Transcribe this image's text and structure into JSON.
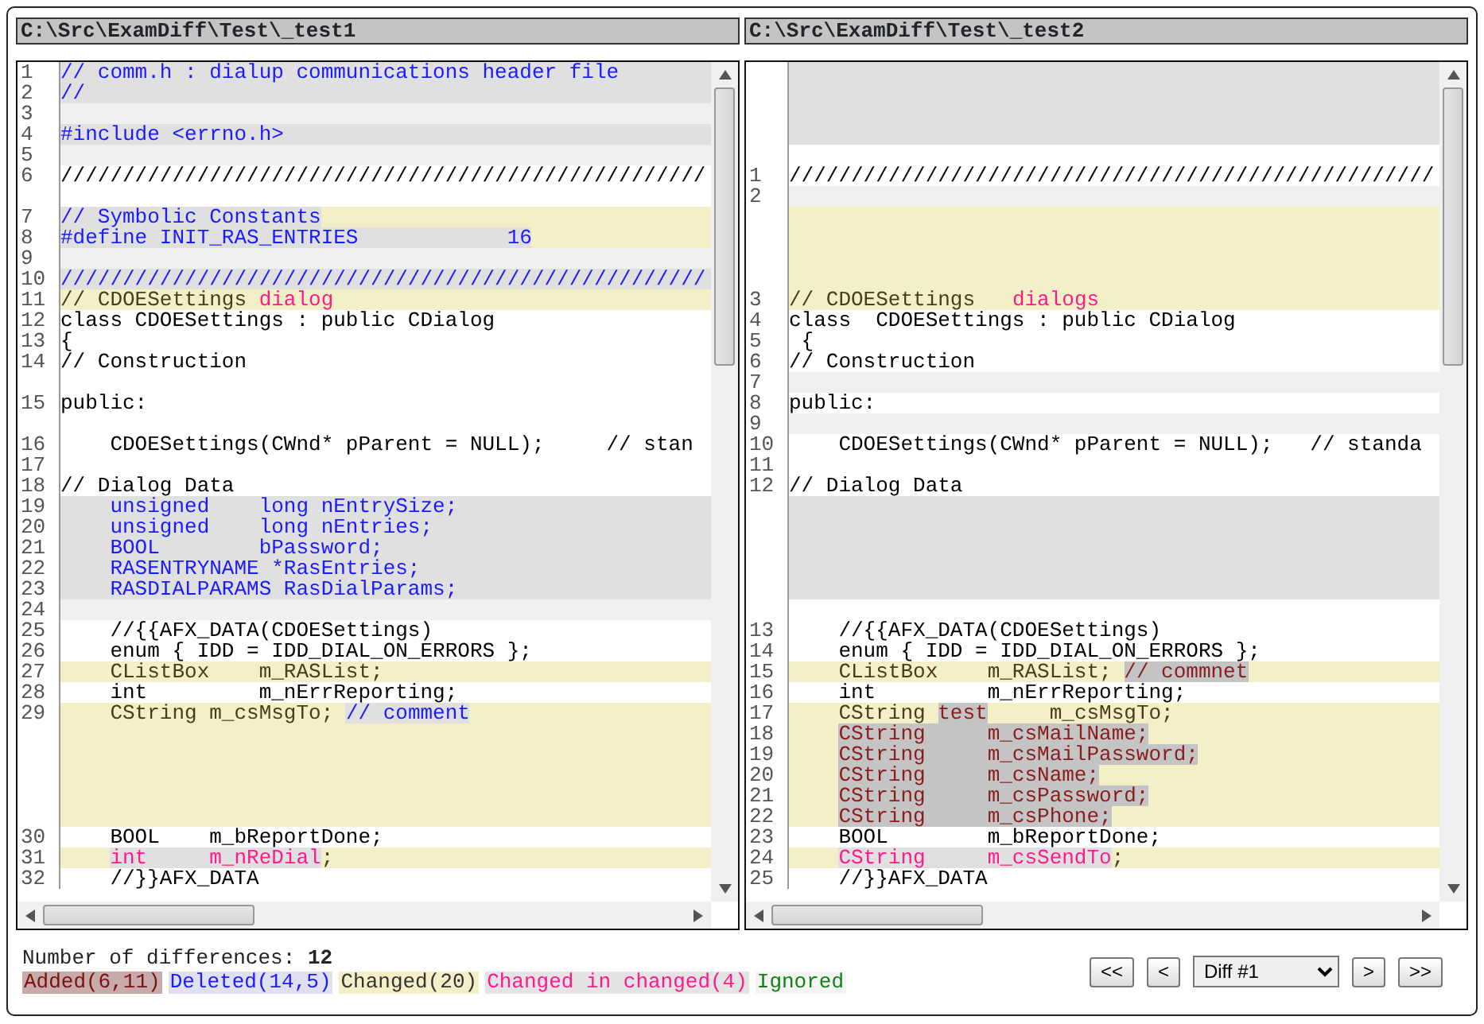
{
  "panes": [
    {
      "path": "C:\\Src\\ExamDiff\\Test\\_test1",
      "lines": [
        {
          "num": "1",
          "kind": "deleted",
          "segments": [
            {
              "text": "// comm.h : dialup communications header file",
              "kind": "plain"
            }
          ]
        },
        {
          "num": "2",
          "kind": "deleted",
          "segments": [
            {
              "text": "//",
              "kind": "plain"
            }
          ]
        },
        {
          "num": "3",
          "kind": "ignored"
        },
        {
          "num": "4",
          "kind": "deleted",
          "segments": [
            {
              "text": "#include <errno.h>",
              "kind": "plain"
            }
          ]
        },
        {
          "num": "5",
          "kind": "ignored"
        },
        {
          "num": "6",
          "kind": "same",
          "segments": [
            {
              "text": "////////////////////////////////////////////////////",
              "kind": "plain"
            }
          ]
        },
        {
          "kind": "same"
        },
        {
          "num": "7",
          "kind": "changed",
          "segments": [
            {
              "text": "// Symbolic Constants",
              "kind": "del-hl"
            }
          ]
        },
        {
          "num": "8",
          "kind": "changed",
          "segments": [
            {
              "text": "#define INIT_RAS_ENTRIES            16",
              "kind": "del-hl"
            }
          ]
        },
        {
          "num": "9",
          "kind": "ignored"
        },
        {
          "num": "10",
          "kind": "deleted",
          "segments": [
            {
              "text": "////////////////////////////////////////////////////",
              "kind": "plain"
            }
          ]
        },
        {
          "num": "11",
          "kind": "changed",
          "segments": [
            {
              "text": "// CDOESettings ",
              "kind": "plain"
            },
            {
              "text": "dialog",
              "kind": "cic"
            }
          ]
        },
        {
          "num": "12",
          "kind": "same",
          "segments": [
            {
              "text": "class CDOESettings : public CDialog",
              "kind": "plain"
            }
          ]
        },
        {
          "num": "13",
          "kind": "same",
          "segments": [
            {
              "text": "{",
              "kind": "plain"
            }
          ]
        },
        {
          "num": "14",
          "kind": "same",
          "segments": [
            {
              "text": "// Construction",
              "kind": "plain"
            }
          ]
        },
        {
          "kind": "same"
        },
        {
          "num": "15",
          "kind": "same",
          "segments": [
            {
              "text": "public:",
              "kind": "plain"
            }
          ]
        },
        {
          "kind": "same"
        },
        {
          "num": "16",
          "kind": "same",
          "segments": [
            {
              "text": "    CDOESettings(CWnd* pParent = NULL);     // stan",
              "kind": "plain"
            }
          ]
        },
        {
          "num": "17",
          "kind": "same"
        },
        {
          "num": "18",
          "kind": "same",
          "segments": [
            {
              "text": "// Dialog Data",
              "kind": "plain"
            }
          ]
        },
        {
          "num": "19",
          "kind": "deleted",
          "segments": [
            {
              "text": "    unsigned    long nEntrySize;",
              "kind": "plain"
            }
          ]
        },
        {
          "num": "20",
          "kind": "deleted",
          "segments": [
            {
              "text": "    unsigned    long nEntries;",
              "kind": "plain"
            }
          ]
        },
        {
          "num": "21",
          "kind": "deleted",
          "segments": [
            {
              "text": "    BOOL        bPassword;",
              "kind": "plain"
            }
          ]
        },
        {
          "num": "22",
          "kind": "deleted",
          "segments": [
            {
              "text": "    RASENTRYNAME *RasEntries;",
              "kind": "plain"
            }
          ]
        },
        {
          "num": "23",
          "kind": "deleted",
          "segments": [
            {
              "text": "    RASDIALPARAMS RasDialParams;",
              "kind": "plain"
            }
          ]
        },
        {
          "num": "24",
          "kind": "ignored"
        },
        {
          "num": "25",
          "kind": "same",
          "segments": [
            {
              "text": "    //{{AFX_DATA(CDOESettings)",
              "kind": "plain"
            }
          ]
        },
        {
          "num": "26",
          "kind": "same",
          "segments": [
            {
              "text": "    enum { IDD = IDD_DIAL_ON_ERRORS };",
              "kind": "plain"
            }
          ]
        },
        {
          "num": "27",
          "kind": "changed",
          "segments": [
            {
              "text": "    CListBox    m_RASList;",
              "kind": "plain"
            }
          ]
        },
        {
          "num": "28",
          "kind": "same",
          "segments": [
            {
              "text": "    int         m_nErrReporting;",
              "kind": "plain"
            }
          ]
        },
        {
          "num": "29",
          "kind": "changed",
          "segments": [
            {
              "text": "    CString m_csMsgTo; ",
              "kind": "plain"
            },
            {
              "text": "// comment",
              "kind": "del-hl"
            }
          ]
        },
        {
          "kind": "changed"
        },
        {
          "kind": "changed"
        },
        {
          "kind": "changed"
        },
        {
          "kind": "changed"
        },
        {
          "kind": "changed"
        },
        {
          "num": "30",
          "kind": "same",
          "segments": [
            {
              "text": "    BOOL    m_bReportDone;",
              "kind": "plain"
            }
          ]
        },
        {
          "num": "31",
          "kind": "changed",
          "indented": true,
          "segments": [
            {
              "text": "int     m_nReDial",
              "kind": "cic-hl"
            },
            {
              "text": ";",
              "kind": "plain"
            }
          ]
        },
        {
          "num": "32",
          "kind": "same",
          "segments": [
            {
              "text": "    //}}AFX_DATA",
              "kind": "plain"
            }
          ]
        }
      ]
    },
    {
      "path": "C:\\Src\\ExamDiff\\Test\\_test2",
      "lines": [
        {
          "kind": "deleted"
        },
        {
          "kind": "deleted"
        },
        {
          "kind": "deleted"
        },
        {
          "kind": "deleted"
        },
        {
          "kind": "same"
        },
        {
          "num": "1",
          "kind": "same",
          "segments": [
            {
              "text": "////////////////////////////////////////////////////",
              "kind": "plain"
            }
          ]
        },
        {
          "num": "2",
          "kind": "ignored"
        },
        {
          "kind": "changed"
        },
        {
          "kind": "changed"
        },
        {
          "kind": "changed"
        },
        {
          "kind": "changed"
        },
        {
          "num": "3",
          "kind": "changed",
          "segments": [
            {
              "text": "// CDOESettings   ",
              "kind": "plain"
            },
            {
              "text": "dialogs",
              "kind": "cic"
            }
          ]
        },
        {
          "num": "4",
          "kind": "same",
          "segments": [
            {
              "text": "class  CDOESettings : public CDialog",
              "kind": "plain"
            }
          ]
        },
        {
          "num": "5",
          "kind": "same",
          "segments": [
            {
              "text": " {",
              "kind": "plain"
            }
          ]
        },
        {
          "num": "6",
          "kind": "same",
          "segments": [
            {
              "text": "// Construction",
              "kind": "plain"
            }
          ]
        },
        {
          "num": "7",
          "kind": "ignored"
        },
        {
          "num": "8",
          "kind": "same",
          "segments": [
            {
              "text": "public:",
              "kind": "plain"
            }
          ]
        },
        {
          "num": "9",
          "kind": "ignored"
        },
        {
          "num": "10",
          "kind": "same",
          "segments": [
            {
              "text": "    CDOESettings(CWnd* pParent = NULL);   // standa",
              "kind": "plain"
            }
          ]
        },
        {
          "num": "11",
          "kind": "same"
        },
        {
          "num": "12",
          "kind": "same",
          "segments": [
            {
              "text": "// Dialog Data",
              "kind": "plain"
            }
          ]
        },
        {
          "kind": "deleted"
        },
        {
          "kind": "deleted"
        },
        {
          "kind": "deleted"
        },
        {
          "kind": "deleted"
        },
        {
          "kind": "deleted"
        },
        {
          "kind": "same"
        },
        {
          "num": "13",
          "kind": "same",
          "segments": [
            {
              "text": "    //{{AFX_DATA(CDOESettings)",
              "kind": "plain"
            }
          ]
        },
        {
          "num": "14",
          "kind": "same",
          "segments": [
            {
              "text": "    enum { IDD = IDD_DIAL_ON_ERRORS };",
              "kind": "plain"
            }
          ]
        },
        {
          "num": "15",
          "kind": "changed",
          "segments": [
            {
              "text": "    CListBox    m_RASList; ",
              "kind": "plain"
            },
            {
              "text": "// commnet",
              "kind": "add-hl"
            }
          ]
        },
        {
          "num": "16",
          "kind": "same",
          "segments": [
            {
              "text": "    int         m_nErrReporting;",
              "kind": "plain"
            }
          ]
        },
        {
          "num": "17",
          "kind": "changed",
          "segments": [
            {
              "text": "    CString ",
              "kind": "plain"
            },
            {
              "text": "test",
              "kind": "add-hl"
            },
            {
              "text": "     m_csMsgTo;",
              "kind": "plain"
            }
          ]
        },
        {
          "num": "18",
          "kind": "changed",
          "indented": true,
          "segments": [
            {
              "text": "CString     m_csMailName;",
              "kind": "add-hl"
            }
          ]
        },
        {
          "num": "19",
          "kind": "changed",
          "indented": true,
          "segments": [
            {
              "text": "CString     m_csMailPassword;",
              "kind": "add-hl"
            }
          ]
        },
        {
          "num": "20",
          "kind": "changed",
          "indented": true,
          "segments": [
            {
              "text": "CString     m_csName;",
              "kind": "add-hl"
            }
          ]
        },
        {
          "num": "21",
          "kind": "changed",
          "indented": true,
          "segments": [
            {
              "text": "CString     m_csPassword;",
              "kind": "add-hl"
            }
          ]
        },
        {
          "num": "22",
          "kind": "changed",
          "indented": true,
          "segments": [
            {
              "text": "CString     m_csPhone;",
              "kind": "add-hl"
            }
          ]
        },
        {
          "num": "23",
          "kind": "same",
          "segments": [
            {
              "text": "    BOOL        m_bReportDone;",
              "kind": "plain"
            }
          ]
        },
        {
          "num": "24",
          "kind": "changed",
          "indented": true,
          "segments": [
            {
              "text": "CString     m_csSendTo",
              "kind": "cic-hl"
            },
            {
              "text": ";",
              "kind": "plain"
            }
          ]
        },
        {
          "num": "25",
          "kind": "same",
          "segments": [
            {
              "text": "    //}}AFX_DATA",
              "kind": "plain"
            }
          ]
        }
      ]
    }
  ],
  "summary": "Number of differences: **12**",
  "legend": [
    {
      "kind": "added",
      "text": "Added(6,11)"
    },
    {
      "kind": "deleted",
      "text": "Deleted(14,5)"
    },
    {
      "kind": "changed",
      "text": "Changed(20)"
    },
    {
      "kind": "cic",
      "text": "Changed in changed(4)"
    },
    {
      "kind": "ignored",
      "text": "Ignored"
    }
  ],
  "nav": {
    "first": "<<",
    "prev": "<",
    "select": "Diff #1",
    "next": ">",
    "last": ">>"
  }
}
